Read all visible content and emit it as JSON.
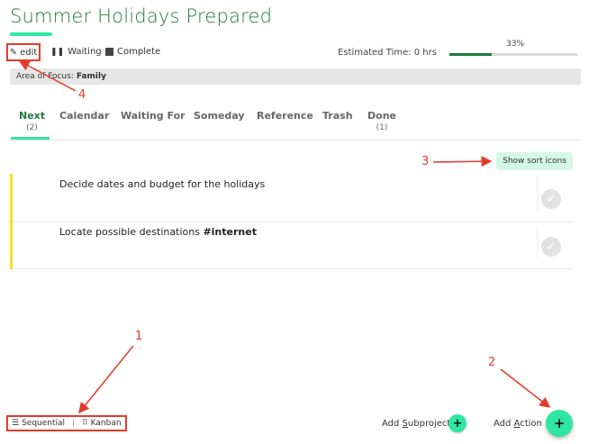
{
  "project": {
    "title": "Summer Holidays Prepared"
  },
  "toolbar": {
    "edit_label": "edit",
    "waiting_label": "Waiting",
    "complete_label": "Complete",
    "estimated_time": "Estimated Time: 0 hrs",
    "progress_label": "33%",
    "progress_fraction": 0.33
  },
  "focus": {
    "prefix": "Area of Focus:",
    "value": "Family"
  },
  "tabs": [
    {
      "label": "Next",
      "count": "(2)"
    },
    {
      "label": "Calendar"
    },
    {
      "label": "Waiting For"
    },
    {
      "label": "Someday"
    },
    {
      "label": "Reference"
    },
    {
      "label": "Trash"
    },
    {
      "label": "Done",
      "count": "(1)"
    }
  ],
  "sort_button": {
    "label": "Show sort icons"
  },
  "actions": [
    {
      "text": "Decide dates and budget for the holidays",
      "tag": ""
    },
    {
      "text": "Locate possible destinations ",
      "tag": "#internet"
    }
  ],
  "footer": {
    "sequential_label": "Sequential",
    "separator": "|",
    "kanban_label": "Kanban",
    "add_subproject_prefix": "Add ",
    "add_subproject_key": "S",
    "add_subproject_rest": "ubproject",
    "add_action_prefix": "Add ",
    "add_action_key": "A",
    "add_action_rest": "ction",
    "plus": "+"
  },
  "annotations": {
    "a1": "1",
    "a2": "2",
    "a3": "3",
    "a4": "4"
  },
  "colors": {
    "brand_green": "#1e7a3c",
    "accent_mint": "#2ee6a1",
    "annotation_red": "#e43a2a",
    "priority_yellow": "#f5df2a"
  }
}
